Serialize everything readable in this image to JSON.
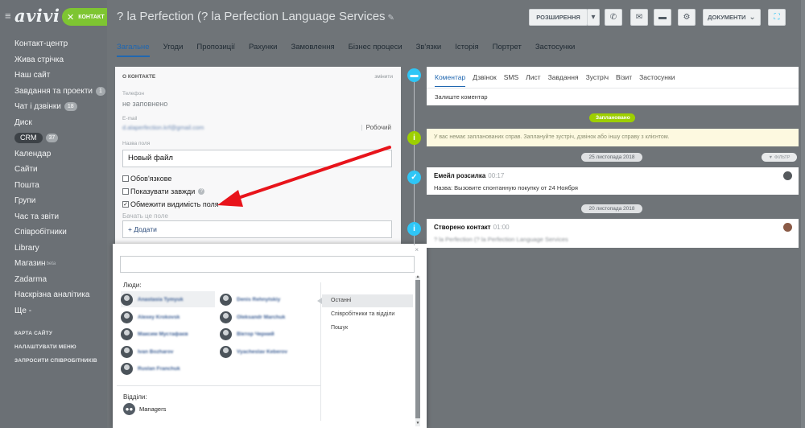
{
  "sidebar": {
    "logo": "avivi",
    "contact_button": "КОНТАКТ",
    "items": [
      {
        "label": "Контакт-центр"
      },
      {
        "label": "Жива стрічка"
      },
      {
        "label": "Наш сайт"
      },
      {
        "label": "Завдання та проекти",
        "badge": "1"
      },
      {
        "label": "Чат і дзвінки",
        "badge": "18"
      },
      {
        "label": "Диск"
      },
      {
        "label": "CRM",
        "badge": "37"
      },
      {
        "label": "Календар"
      },
      {
        "label": "Сайти"
      },
      {
        "label": "Пошта"
      },
      {
        "label": "Групи"
      },
      {
        "label": "Час та звіти"
      },
      {
        "label": "Співробітники"
      },
      {
        "label": "Library"
      },
      {
        "label": "Магазин",
        "sup": "beta"
      },
      {
        "label": "Zadarma"
      },
      {
        "label": "Наскрізна аналітика"
      },
      {
        "label": "Ще -"
      }
    ],
    "bottom_links": [
      "КАРТА САЙТУ",
      "НАЛАШТУВАТИ МЕНЮ",
      "ЗАПРОСИТИ СПІВРОБІТНИКІВ"
    ]
  },
  "header": {
    "title": "? la Perfection (? la Perfection Language  Services",
    "expand_button": "РОЗШИРЕННЯ",
    "documents_button": "ДОКУМЕНТИ"
  },
  "tabs": [
    {
      "label": "Загальне",
      "active": true
    },
    {
      "label": "Угоди"
    },
    {
      "label": "Пропозиції"
    },
    {
      "label": "Рахунки"
    },
    {
      "label": "Замовлення"
    },
    {
      "label": "Бізнес процеси"
    },
    {
      "label": "Зв'язки"
    },
    {
      "label": "Історія"
    },
    {
      "label": "Портрет"
    },
    {
      "label": "Застосунки"
    }
  ],
  "contact_card": {
    "heading": "О КОНТАКТЕ",
    "edit_link": "змінити",
    "phone_label": "Телефон",
    "phone_value": "не заповнено",
    "email_label": "E-mail",
    "email_value": "d.alaperfection.krf@gmail.com",
    "email_type": "Робочий",
    "field_name_label": "Назва поля",
    "field_name_value": "Новый файл",
    "checkbox_required": "Обов'язкове",
    "checkbox_always_show": "Показувати завжди",
    "checkbox_restrict": "Обмежити видимість поля",
    "checkbox_restrict_checked": true,
    "start_typing_hint": "Бачать це поле",
    "add_button": "+ Додати"
  },
  "popup": {
    "close": "×",
    "people_label": "Люди:",
    "people": [
      {
        "name": "Anastasia Tymyuk"
      },
      {
        "name": "Denis Rehnytskiy"
      },
      {
        "name": "Alexey Krokovsk"
      },
      {
        "name": "Oleksandr Marchuk"
      },
      {
        "name": "Максим Мустафаєв"
      },
      {
        "name": "Віктор Черний"
      },
      {
        "name": "Ivan Bozharov"
      },
      {
        "name": "Vyacheslav Keberov"
      },
      {
        "name": "Ruslan Franchuk"
      }
    ],
    "departments_label": "Відділи:",
    "department": "Managers",
    "right_options": [
      {
        "label": "Останні",
        "selected": true
      },
      {
        "label": "Співробітники та відділи"
      },
      {
        "label": "Пошук"
      }
    ]
  },
  "timeline": {
    "composer_tabs": [
      {
        "label": "Коментар",
        "active": true
      },
      {
        "label": "Дзвінок"
      },
      {
        "label": "SMS"
      },
      {
        "label": "Лист"
      },
      {
        "label": "Завдання"
      },
      {
        "label": "Зустріч"
      },
      {
        "label": "Візит"
      },
      {
        "label": "Застосунки"
      }
    ],
    "composer_placeholder": "Залиште коментар",
    "planned_pill": "Заплановано",
    "planned_text": "У вас немає запланованих справ. Заплануйте зустріч, дзвінок або іншу справу з клієнтом.",
    "filter": "ФІЛЬТР",
    "date1": "25 листопада 2018",
    "entry1_title": "Емейл розсилка",
    "entry1_time": "00:17",
    "entry1_text": "Назва: Вызовите спонтанную покупку от 24 Ноября",
    "date2": "20 листопада 2018",
    "entry2_title": "Створено контакт",
    "entry2_time": "01:00",
    "entry2_text": "? la Perfection (? la Perfection Language Services"
  },
  "colors": {
    "accent_blue": "#2067b0",
    "green": "#9dcf00",
    "timeline_blue": "#2fc6f6",
    "arrow_red": "#e8141b"
  }
}
